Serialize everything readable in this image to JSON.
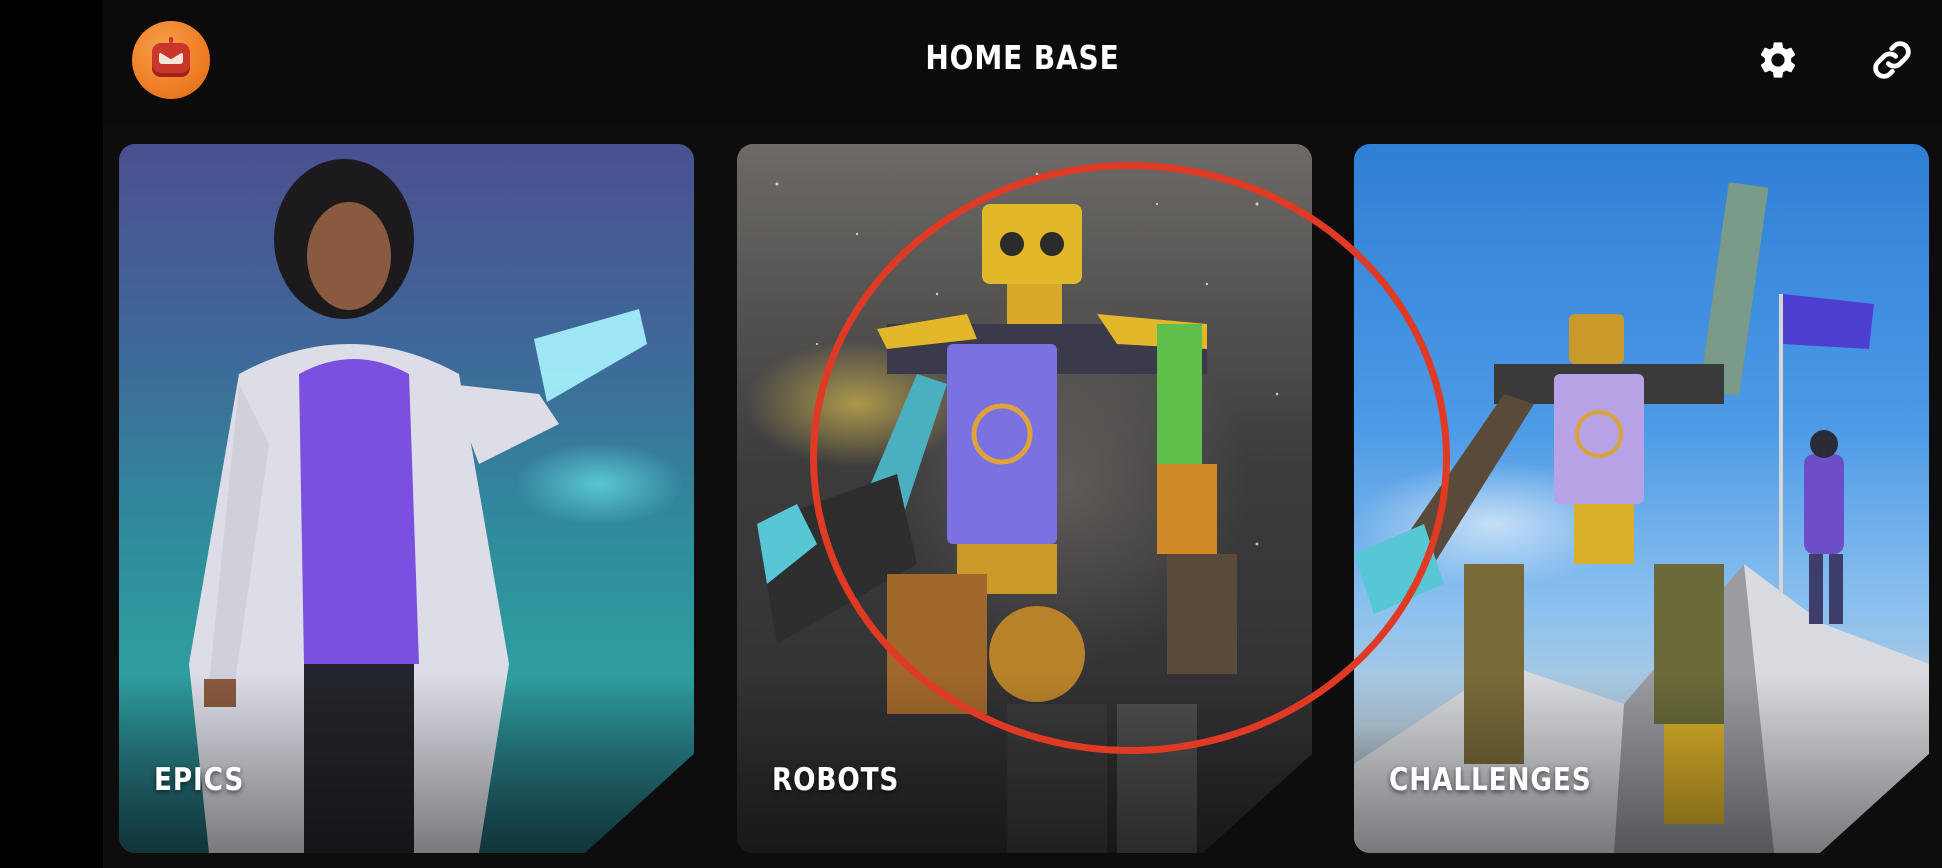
{
  "header": {
    "title": "HOME BASE",
    "avatar_icon": "robot-avatar-icon",
    "settings_icon": "gear-icon",
    "link_icon": "link-icon"
  },
  "cards": [
    {
      "label": "EPICS"
    },
    {
      "label": "ROBOTS"
    },
    {
      "label": "CHALLENGES"
    }
  ],
  "colors": {
    "background": "#0d0d0d",
    "avatar": "#ef7d25",
    "highlight": "#e03a24",
    "text": "#ffffff"
  }
}
